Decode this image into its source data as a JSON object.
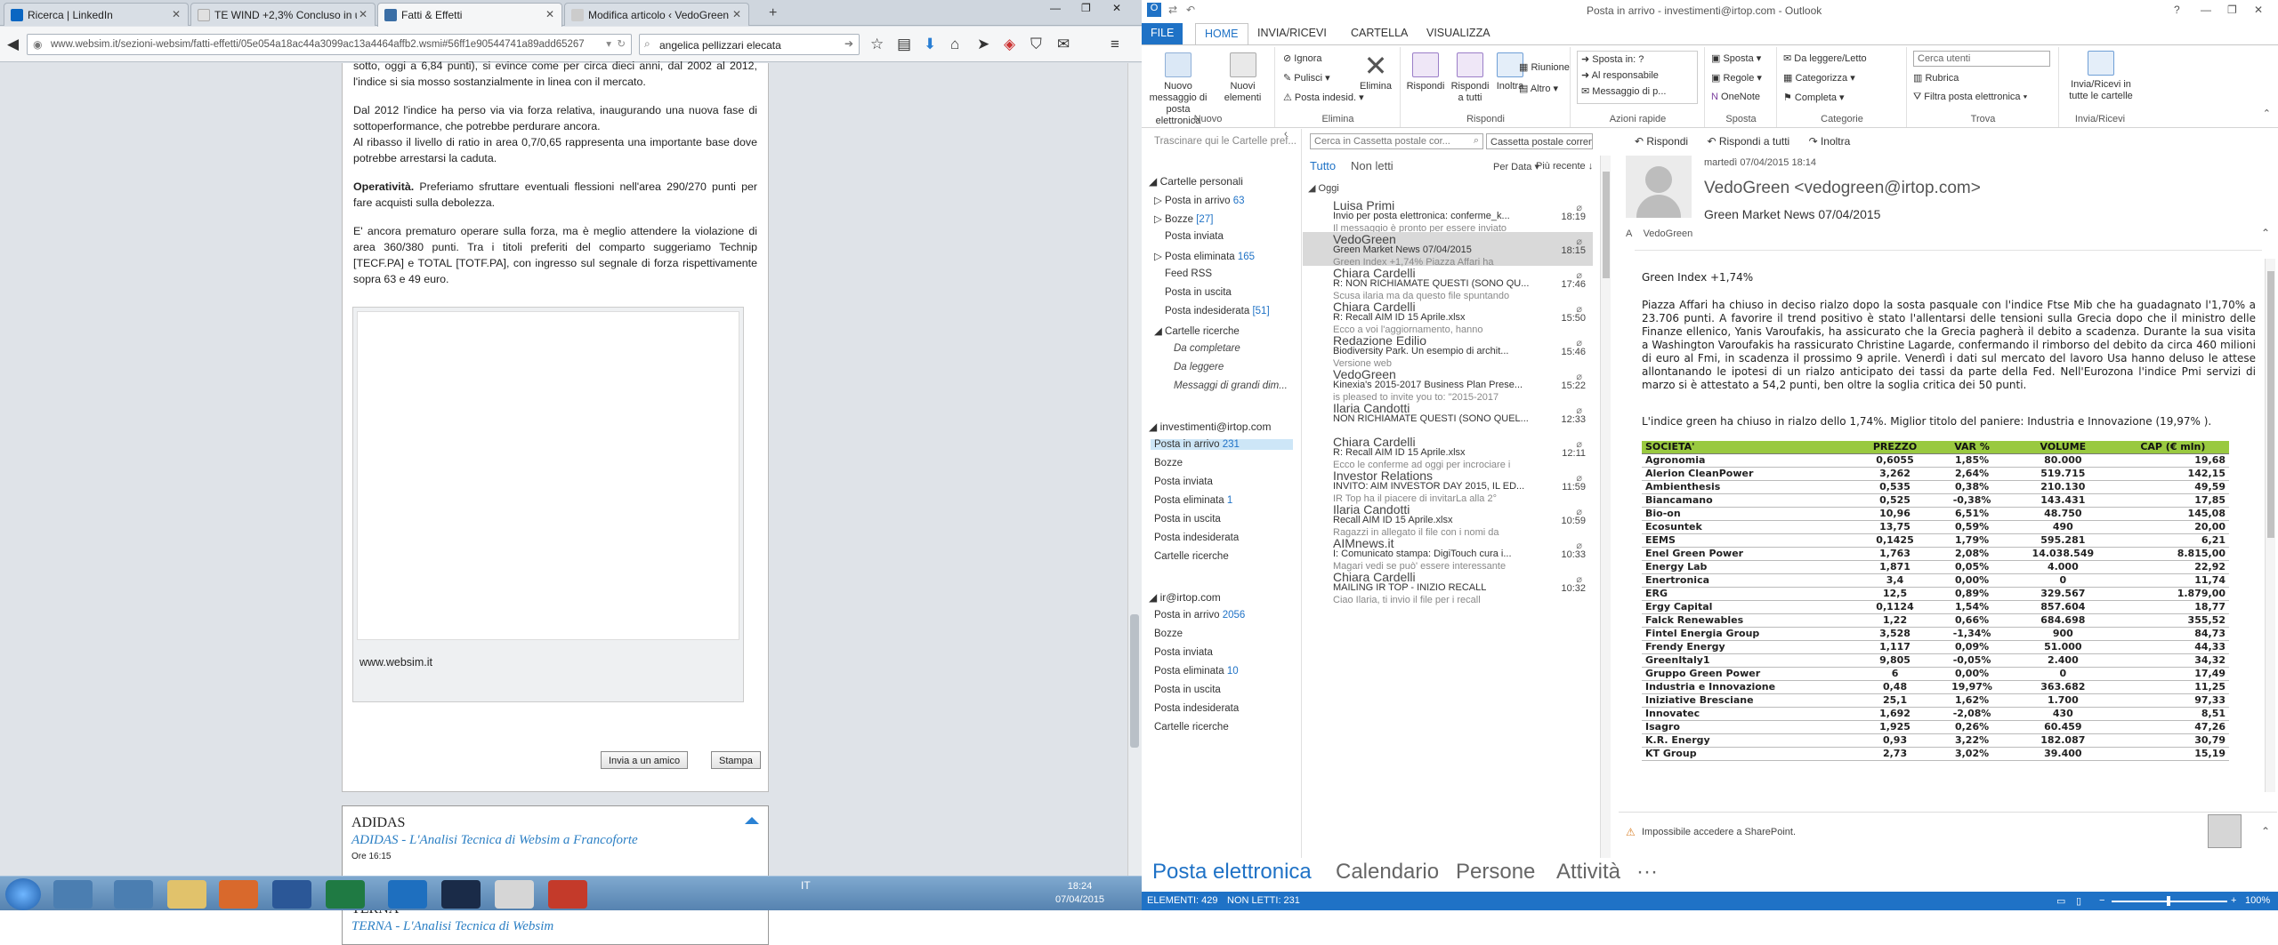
{
  "browser": {
    "tabs": [
      {
        "label": "Ricerca | LinkedIn",
        "active": false
      },
      {
        "label": "TE WIND +2,3% Concluso in u...",
        "active": false
      },
      {
        "label": "Fatti & Effetti",
        "active": true
      },
      {
        "label": "Modifica articolo ‹ VedoGreen ...",
        "active": false
      }
    ],
    "url": "www.websim.it/sezioni-websim/fatti-effetti/05e054a18ac44a3099ac13a4464affb2.wsmi#56ff1e90544741a89add65267",
    "search_value": "angelica pellizzari elecata"
  },
  "article": {
    "paragraphs": [
      "sotto, oggi a 6,84 punti), si evince come per circa dieci anni, dal 2002 al 2012, l'indice si sia mosso sostanzialmente in linea con il mercato.",
      "Dal 2012 l'indice ha perso via via forza relativa, inaugurando una nuova fase di sottoperformance, che potrebbe perdurare ancora.",
      "Al ribasso il livello di ratio in area 0,7/0,65 rappresenta una importante base dove potrebbe arrestarsi la caduta."
    ],
    "operativita_label": "Operatività.",
    "operativita_text": " Preferiamo sfruttare eventuali flessioni nell'area 290/270 punti per fare acquisti sulla debolezza.",
    "last_paragraph": "E' ancora prematuro operare sulla forza, ma è meglio attendere la violazione di area 360/380 punti. Tra i titoli preferiti del comparto suggeriamo Technip [TECF.PA] e TOTAL [TOTF.PA], con ingresso sul segnale di forza rispettivamente sopra 63 e 49 euro.",
    "site": "www.websim.it",
    "invite_button": "Invia a un amico",
    "print_button": "Stampa",
    "cards": [
      {
        "title": "ADIDAS",
        "subtitle": "ADIDAS - L'Analisi Tecnica di Websim a Francoforte",
        "time": "Ore 16:15"
      },
      {
        "title": "TERNA",
        "subtitle": "TERNA - L'Analisi Tecnica di Websim",
        "time": ""
      }
    ]
  },
  "outlook": {
    "window_title": "Posta in arrivo - investimenti@irtop.com - Outlook",
    "menu_tabs": [
      "FILE",
      "HOME",
      "INVIA/RICEVI",
      "CARTELLA",
      "VISUALIZZA"
    ],
    "ribbon": {
      "nuovo_messaggio": "Nuovo messaggio di posta elettronica",
      "nuovi_elementi": "Nuovi elementi",
      "ignora": "Ignora",
      "pulisci": "Pulisci",
      "posta_indesiderata": "Posta indesid.",
      "elimina": "Elimina",
      "rispondi": "Rispondi",
      "rispondi_tutti": "Rispondi a tutti",
      "inoltra": "Inoltra",
      "riunione": "Riunione",
      "altro": "Altro",
      "sposta_in": "Sposta in: ?",
      "al_responsabile": "Al responsabile",
      "messaggio_di": "Messaggio di p...",
      "sposta": "Sposta",
      "regole": "Regole",
      "onenote": "OneNote",
      "da_leggere": "Da leggere/Letto",
      "categorizza": "Categorizza",
      "completa": "Completa",
      "cerca_utenti": "Cerca utenti",
      "rubrica": "Rubrica",
      "filtra": "Filtra posta elettronica",
      "invia_ricevi": "Invia/Ricevi in tutte le cartelle",
      "groups": [
        "Nuovo",
        "Elimina",
        "Rispondi",
        "Azioni rapide",
        "Sposta",
        "Categorie",
        "Trova",
        "Invia/Ricevi"
      ]
    },
    "favorites_hint": "Trascinare qui le Cartelle pref...",
    "folders": {
      "personal_header": "Cartelle personali",
      "personal": [
        {
          "name": "Posta in arrivo",
          "count": "63"
        },
        {
          "name": "Bozze",
          "count": "[27]"
        },
        {
          "name": "Posta inviata",
          "count": ""
        },
        {
          "name": "Posta eliminata",
          "count": "165"
        },
        {
          "name": "Feed RSS",
          "count": ""
        },
        {
          "name": "Posta in uscita",
          "count": ""
        },
        {
          "name": "Posta indesiderata",
          "count": "[51]"
        },
        {
          "name": "Cartelle ricerche",
          "count": ""
        }
      ],
      "search_folders": [
        "Da completare",
        "Da leggere",
        "Messaggi di grandi dim..."
      ],
      "account1": "investimenti@irtop.com",
      "account1_folders": [
        {
          "name": "Posta in arrivo",
          "count": "231"
        },
        {
          "name": "Bozze",
          "count": ""
        },
        {
          "name": "Posta inviata",
          "count": ""
        },
        {
          "name": "Posta eliminata",
          "count": "1"
        },
        {
          "name": "Posta in uscita",
          "count": ""
        },
        {
          "name": "Posta indesiderata",
          "count": ""
        },
        {
          "name": "Cartelle ricerche",
          "count": ""
        }
      ],
      "account2": "ir@irtop.com",
      "account2_folders": [
        {
          "name": "Posta in arrivo",
          "count": "2056"
        },
        {
          "name": "Bozze",
          "count": ""
        },
        {
          "name": "Posta inviata",
          "count": ""
        },
        {
          "name": "Posta eliminata",
          "count": "10"
        },
        {
          "name": "Posta in uscita",
          "count": ""
        },
        {
          "name": "Posta indesiderata",
          "count": ""
        },
        {
          "name": "Cartelle ricerche",
          "count": ""
        }
      ]
    },
    "list": {
      "search_placeholder": "Cerca in Cassetta postale cor...",
      "mailbox": "Cassetta postale corrente",
      "filter_all": "Tutto",
      "filter_unread": "Non letti",
      "sort_by": "Per Data",
      "sort_order": "Più recente",
      "group_label": "Oggi",
      "messages": [
        {
          "from": "Luisa Primi",
          "subject": "Invio per posta elettronica: conferme_k...",
          "preview": "Il messaggio è pronto per essere inviato",
          "time": "18:19"
        },
        {
          "from": "VedoGreen",
          "subject": "Green Market News 07/04/2015",
          "preview": "Green Index +1,74%  Piazza Affari ha",
          "time": "18:15"
        },
        {
          "from": "Chiara Cardelli",
          "subject": "R: NON RICHIAMATE QUESTI (SONO QU...",
          "preview": "Scusa ilaria ma da questo file spuntando",
          "time": "17:46"
        },
        {
          "from": "Chiara Cardelli",
          "subject": "R: Recall AIM ID 15 Aprile.xlsx",
          "preview": "Ecco a voi l'aggiornamento, hanno",
          "time": "15:50"
        },
        {
          "from": "Redazione Edilio",
          "subject": "Biodiversity Park.  Un esempio di archit...",
          "preview": "Versione web",
          "time": "15:46"
        },
        {
          "from": "VedoGreen",
          "subject": "Kinexia's 2015-2017 Business Plan Prese...",
          "preview": "is pleased to invite you to:  \"2015-2017",
          "time": "15:22"
        },
        {
          "from": "Ilaria Candotti",
          "subject": "NON RICHIAMATE QUESTI (SONO QUEL...",
          "preview": "",
          "time": "12:33"
        },
        {
          "from": "Chiara Cardelli",
          "subject": "R: Recall AIM ID 15 Aprile.xlsx",
          "preview": "Ecco le conferme ad oggi per incrociare i",
          "time": "12:11"
        },
        {
          "from": "Investor Relations",
          "subject": "INVITO: AIM INVESTOR DAY  2015, IL ED...",
          "preview": "IR Top ha il piacere di invitarLa alla 2°",
          "time": "11:59"
        },
        {
          "from": "Ilaria Candotti",
          "subject": "Recall AIM ID 15 Aprile.xlsx",
          "preview": "Ragazzi in allegato il file con i nomi da",
          "time": "10:59"
        },
        {
          "from": "AIMnews.it",
          "subject": "I: Comunicato stampa: DigiTouch cura i...",
          "preview": "Magari vedi se può' essere interessante",
          "time": "10:33"
        },
        {
          "from": "Chiara Cardelli",
          "subject": "MAILING IR TOP - INIZIO RECALL",
          "preview": "Ciao Ilaria, ti invio il file per i recall",
          "time": "10:32"
        }
      ]
    },
    "reading": {
      "reply": "Rispondi",
      "reply_all": "Rispondi a tutti",
      "forward": "Inoltra",
      "date": "martedì 07/04/2015 18:14",
      "from": "VedoGreen <vedogreen@irtop.com>",
      "subject": "Green Market News 07/04/2015",
      "to_label": "A",
      "to": "VedoGreen",
      "heading": "Green Index +1,74%",
      "body1": "Piazza Affari ha chiuso in deciso rialzo dopo la sosta pasquale con l'indice Ftse Mib che ha guadagnato l'1,70% a 23.706 punti. A favorire il trend positivo è stato l'allentarsi delle tensioni sulla Grecia dopo che il ministro delle Finanze ellenico, Yanis Varoufakis, ha assicurato che la Grecia pagherà il debito a scadenza. Durante la sua visita a Washington Varoufakis ha rassicurato Christine Lagarde, confermando il rimborso del debito da circa 460 milioni di euro al Fmi, in scadenza il prossimo 9 aprile. Venerdì i dati sul mercato del lavoro Usa hanno deluso le attese allontanando le ipotesi di un rialzo anticipato dei tassi da parte della Fed. Nell'Eurozona l'indice Pmi servizi di marzo si è attestato a 54,2 punti, ben oltre la soglia critica dei 50 punti.",
      "body2": "L'indice green ha chiuso in rialzo dello 1,74%. Miglior titolo del paniere: Industria e Innovazione (19,97% ).",
      "table_headers": [
        "SOCIETA'",
        "PREZZO",
        "VAR %",
        "VOLUME",
        "CAP (€ mln)"
      ],
      "table_rows": [
        [
          "Agronomia",
          "0,6055",
          "1,85%",
          "80.000",
          "19,68"
        ],
        [
          "Alerion CleanPower",
          "3,262",
          "2,64%",
          "519.715",
          "142,15"
        ],
        [
          "Ambienthesis",
          "0,535",
          "0,38%",
          "210.130",
          "49,59"
        ],
        [
          "Biancamano",
          "0,525",
          "-0,38%",
          "143.431",
          "17,85"
        ],
        [
          "Bio-on",
          "10,96",
          "6,51%",
          "48.750",
          "145,08"
        ],
        [
          "Ecosuntek",
          "13,75",
          "0,59%",
          "490",
          "20,00"
        ],
        [
          "EEMS",
          "0,1425",
          "1,79%",
          "595.281",
          "6,21"
        ],
        [
          "Enel Green Power",
          "1,763",
          "2,08%",
          "14.038.549",
          "8.815,00"
        ],
        [
          "Energy Lab",
          "1,871",
          "0,05%",
          "4.000",
          "22,92"
        ],
        [
          "Enertronica",
          "3,4",
          "0,00%",
          "0",
          "11,74"
        ],
        [
          "ERG",
          "12,5",
          "0,89%",
          "329.567",
          "1.879,00"
        ],
        [
          "Ergy Capital",
          "0,1124",
          "1,54%",
          "857.604",
          "18,77"
        ],
        [
          "Falck Renewables",
          "1,22",
          "0,66%",
          "684.698",
          "355,52"
        ],
        [
          "Fintel Energia Group",
          "3,528",
          "-1,34%",
          "900",
          "84,73"
        ],
        [
          "Frendy Energy",
          "1,117",
          "0,09%",
          "51.000",
          "44,33"
        ],
        [
          "GreenItaly1",
          "9,805",
          "-0,05%",
          "2.400",
          "34,32"
        ],
        [
          "Gruppo Green Power",
          "6",
          "0,00%",
          "0",
          "17,49"
        ],
        [
          "Industria e Innovazione",
          "0,48",
          "19,97%",
          "363.682",
          "11,25"
        ],
        [
          "Iniziative Bresciane",
          "25,1",
          "1,62%",
          "1.700",
          "97,33"
        ],
        [
          "Innovatec",
          "1,692",
          "-2,08%",
          "430",
          "8,51"
        ],
        [
          "Isagro",
          "1,925",
          "0,26%",
          "60.459",
          "47,26"
        ],
        [
          "K.R. Energy",
          "0,93",
          "3,22%",
          "182.087",
          "30,79"
        ],
        [
          "KT Group",
          "2,73",
          "3,02%",
          "39.400",
          "15,19"
        ]
      ],
      "sharepoint": "Impossibile accedere a SharePoint."
    },
    "nav": [
      "Posta elettronica",
      "Calendario",
      "Persone",
      "Attività",
      "···"
    ],
    "status": {
      "items": "ELEMENTI: 429",
      "unread": "NON LETTI: 231",
      "zoom": "100%"
    }
  },
  "taskbar": {
    "lang": "IT",
    "time": "18:24",
    "date": "07/04/2015"
  }
}
